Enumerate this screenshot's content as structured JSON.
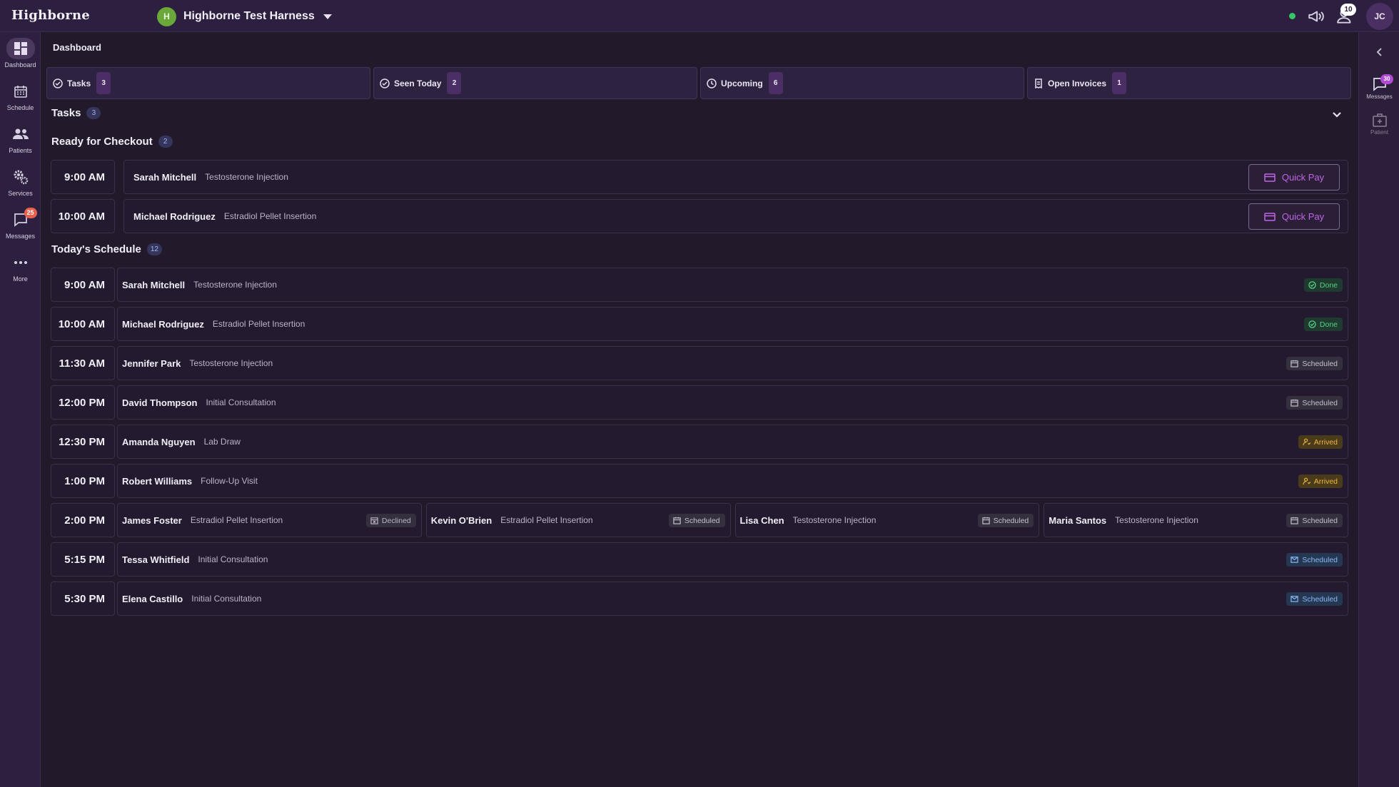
{
  "brand": "Highborne",
  "org": {
    "initial": "H",
    "name": "Highborne Test Harness"
  },
  "topbar": {
    "notifications_count": "10",
    "user_initials": "JC"
  },
  "nav": [
    {
      "label": "Dashboard"
    },
    {
      "label": "Schedule"
    },
    {
      "label": "Patients"
    },
    {
      "label": "Services"
    },
    {
      "label": "Messages",
      "badge": "25"
    },
    {
      "label": "More"
    }
  ],
  "rightrail": {
    "messages_label": "Messages",
    "messages_badge": "30",
    "patient_label": "Patient"
  },
  "breadcrumb": "Dashboard",
  "tabs": [
    {
      "label": "Tasks",
      "count": "3"
    },
    {
      "label": "Seen Today",
      "count": "2"
    },
    {
      "label": "Upcoming",
      "count": "6"
    },
    {
      "label": "Open Invoices",
      "count": "1"
    }
  ],
  "tasks": {
    "title": "Tasks",
    "count": "3"
  },
  "checkout": {
    "title": "Ready for Checkout",
    "count": "2",
    "button_label": "Quick Pay",
    "rows": [
      {
        "time": "9:00 AM",
        "name": "Sarah Mitchell",
        "service": "Testosterone Injection"
      },
      {
        "time": "10:00 AM",
        "name": "Michael Rodriguez",
        "service": "Estradiol Pellet Insertion"
      }
    ]
  },
  "schedule": {
    "title": "Today's Schedule",
    "count": "12",
    "rows": [
      {
        "time": "9:00 AM",
        "entries": [
          {
            "name": "Sarah Mitchell",
            "service": "Testosterone Injection",
            "status": "Done",
            "kind": "done"
          }
        ]
      },
      {
        "time": "10:00 AM",
        "entries": [
          {
            "name": "Michael Rodriguez",
            "service": "Estradiol Pellet Insertion",
            "status": "Done",
            "kind": "done"
          }
        ]
      },
      {
        "time": "11:30 AM",
        "entries": [
          {
            "name": "Jennifer Park",
            "service": "Testosterone Injection",
            "status": "Scheduled",
            "kind": "scheduled"
          }
        ]
      },
      {
        "time": "12:00 PM",
        "entries": [
          {
            "name": "David Thompson",
            "service": "Initial Consultation",
            "status": "Scheduled",
            "kind": "scheduled"
          }
        ]
      },
      {
        "time": "12:30 PM",
        "entries": [
          {
            "name": "Amanda Nguyen",
            "service": "Lab Draw",
            "status": "Arrived",
            "kind": "arrived"
          }
        ]
      },
      {
        "time": "1:00 PM",
        "entries": [
          {
            "name": "Robert Williams",
            "service": "Follow-Up Visit",
            "status": "Arrived",
            "kind": "arrived"
          }
        ]
      },
      {
        "time": "2:00 PM",
        "entries": [
          {
            "name": "James Foster",
            "service": "Estradiol Pellet Insertion",
            "status": "Declined",
            "kind": "declined"
          },
          {
            "name": "Kevin O'Brien",
            "service": "Estradiol Pellet Insertion",
            "status": "Scheduled",
            "kind": "scheduled"
          },
          {
            "name": "Lisa Chen",
            "service": "Testosterone Injection",
            "status": "Scheduled",
            "kind": "scheduled"
          },
          {
            "name": "Maria Santos",
            "service": "Testosterone Injection",
            "status": "Scheduled",
            "kind": "scheduled"
          }
        ]
      },
      {
        "time": "5:15 PM",
        "entries": [
          {
            "name": "Tessa Whitfield",
            "service": "Initial Consultation",
            "status": "Scheduled",
            "kind": "mail"
          }
        ]
      },
      {
        "time": "5:30 PM",
        "entries": [
          {
            "name": "Elena Castillo",
            "service": "Initial Consultation",
            "status": "Scheduled",
            "kind": "mail"
          }
        ]
      }
    ]
  },
  "colors": {
    "accent": "#c065e6",
    "done": "#58d187",
    "arrived": "#f0b440",
    "mail": "#8ab8f6"
  }
}
